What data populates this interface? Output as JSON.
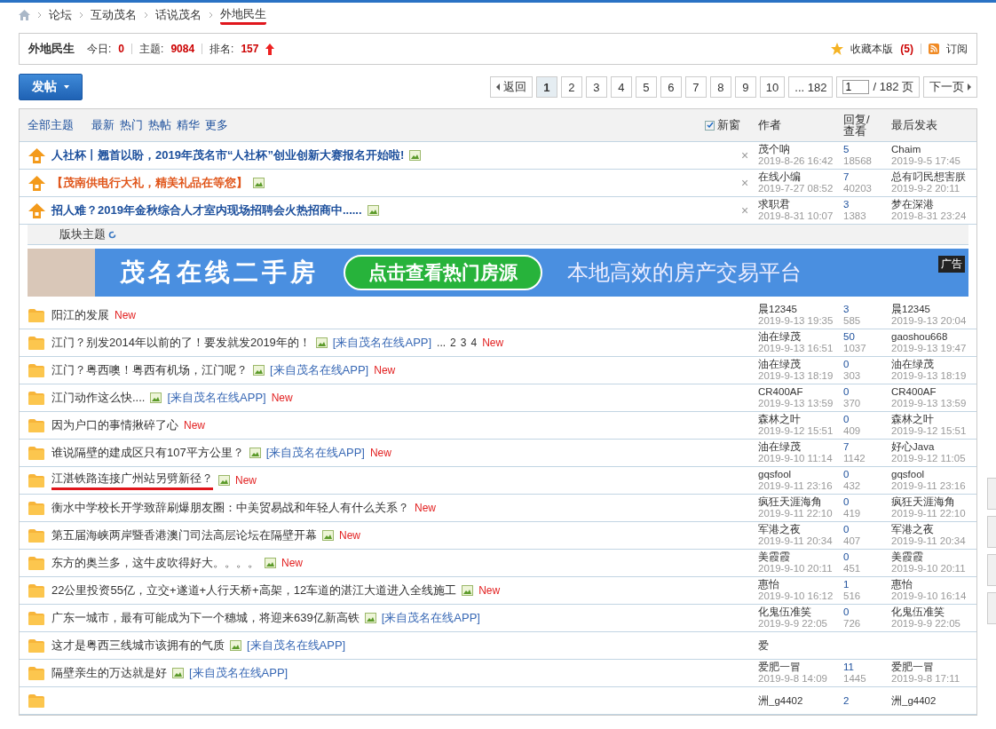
{
  "breadcrumb": [
    {
      "label": "论坛",
      "marked": false
    },
    {
      "label": "互动茂名",
      "marked": false
    },
    {
      "label": "话说茂名",
      "marked": false
    },
    {
      "label": "外地民生",
      "marked": true
    }
  ],
  "forum_header": {
    "name": "外地民生",
    "today_label": "今日:",
    "today": "0",
    "topics_label": "主题:",
    "topics": "9084",
    "rank_label": "排名:",
    "rank": "157",
    "favorite": "收藏本版",
    "favorite_count": "(5)",
    "subscribe": "订阅"
  },
  "post_button": "发帖",
  "pagination": {
    "back": "返回",
    "pages": [
      {
        "label": "1",
        "selected": true
      },
      {
        "label": "2",
        "selected": false
      },
      {
        "label": "3",
        "selected": false
      },
      {
        "label": "4",
        "selected": false
      },
      {
        "label": "5",
        "selected": false
      },
      {
        "label": "6",
        "selected": false
      },
      {
        "label": "7",
        "selected": false
      },
      {
        "label": "8",
        "selected": false
      },
      {
        "label": "9",
        "selected": false
      },
      {
        "label": "10",
        "selected": false
      },
      {
        "label": "... 182",
        "selected": false
      }
    ],
    "page_input": "1",
    "page_total": "/ 182 页",
    "next": "下一页"
  },
  "filters": [
    {
      "label": "全部主题",
      "kind": "main"
    },
    {
      "label": "最新",
      "kind": "sub"
    },
    {
      "label": "热门",
      "kind": "sub"
    },
    {
      "label": "热帖",
      "kind": "sub"
    },
    {
      "label": "精华",
      "kind": "sub"
    },
    {
      "label": "更多",
      "kind": "sub"
    }
  ],
  "new_window": {
    "label": "新窗",
    "checked": true
  },
  "columns": {
    "author": "作者",
    "replies": "回复/查看",
    "last": "最后发表"
  },
  "stickies": [
    {
      "title": "人社杯丨翘首以盼，2019年茂名市“人社杯”创业创新大赛报名开始啦!",
      "color": "#1c4f9c",
      "has_image": true,
      "close": "×",
      "author": "茂个呐",
      "date": "2019-8-26 16:42",
      "replies": "5",
      "views": "18568",
      "last_poster": "Chaim",
      "last_date": "2019-9-5 17:45"
    },
    {
      "title": "【茂南供电行大礼，精美礼品在等您】",
      "color": "#e0561b",
      "has_image": true,
      "close": "×",
      "author": "在线小编",
      "date": "2019-7-27 08:52",
      "replies": "7",
      "views": "40203",
      "last_poster": "总有叼民想害朕",
      "last_date": "2019-9-2 20:11"
    },
    {
      "title": "招人难？2019年金秋综合人才室内现场招聘会火热招商中......",
      "color": "#1c4f9c",
      "has_image": true,
      "close": "×",
      "author": "求职君",
      "date": "2019-8-31 10:07",
      "replies": "3",
      "views": "1383",
      "last_poster": "梦在深港",
      "last_date": "2019-8-31 23:24"
    }
  ],
  "section_label": "版块主题",
  "banner": {
    "headline": "茂名在线二手房",
    "button": "点击查看热门房源",
    "slogan": "本地高效的房产交易平台",
    "ad_tag": "广告"
  },
  "threads": [
    {
      "title": "阳江的发展",
      "has_image": false,
      "new": "New",
      "author": "晨12345",
      "date": "2019-9-13 19:35",
      "replies": "3",
      "views": "585",
      "last_poster": "晨12345",
      "last_date": "2019-9-13 20:04"
    },
    {
      "title": "江门？别发2014年以前的了！要发就发2019年的！",
      "has_image": true,
      "app": "[来自茂名在线APP]",
      "pages": [
        "...",
        "2",
        "3",
        "4"
      ],
      "new": "New",
      "author": "油在绿茂",
      "date": "2019-9-13 16:51",
      "replies": "50",
      "views": "1037",
      "last_poster": "gaoshou668",
      "last_date": "2019-9-13 19:47"
    },
    {
      "title": "江门？粤西噢！粤西有机场，江门呢？",
      "has_image": true,
      "app": "[来自茂名在线APP]",
      "new": "New",
      "author": "油在绿茂",
      "date": "2019-9-13 18:19",
      "replies": "0",
      "views": "303",
      "last_poster": "油在绿茂",
      "last_date": "2019-9-13 18:19"
    },
    {
      "title": "江门动作这么快....",
      "has_image": true,
      "app": "[来自茂名在线APP]",
      "new": "New",
      "author": "CR400AF",
      "date": "2019-9-13 13:59",
      "replies": "0",
      "views": "370",
      "last_poster": "CR400AF",
      "last_date": "2019-9-13 13:59"
    },
    {
      "title": "因为户口的事情揪碎了心",
      "has_image": false,
      "new": "New",
      "author": "森林之叶",
      "date": "2019-9-12 15:51",
      "replies": "0",
      "views": "409",
      "last_poster": "森林之叶",
      "last_date": "2019-9-12 15:51"
    },
    {
      "title": "谁说隔壁的建成区只有107平方公里？",
      "has_image": true,
      "app": "[来自茂名在线APP]",
      "new": "New",
      "author": "油在绿茂",
      "date": "2019-9-10 11:14",
      "replies": "7",
      "views": "1142",
      "last_poster": "好心Java",
      "last_date": "2019-9-12 11:05"
    },
    {
      "title": "江湛铁路连接广州站另劈新径？",
      "has_image": true,
      "new": "New",
      "author": "gqsfool",
      "date": "2019-9-11 23:16",
      "replies": "0",
      "views": "432",
      "last_poster": "gqsfool",
      "last_date": "2019-9-11 23:16",
      "marked": true
    },
    {
      "title": "衡水中学校长开学致辞刷爆朋友圈：中美贸易战和年轻人有什么关系？",
      "has_image": false,
      "new": "New",
      "author": "疯狂天涯海角",
      "date": "2019-9-11 22:10",
      "replies": "0",
      "views": "419",
      "last_poster": "疯狂天涯海角",
      "last_date": "2019-9-11 22:10"
    },
    {
      "title": "第五届海峡两岸暨香港澳门司法高层论坛在隔壁开幕",
      "has_image": true,
      "new": "New",
      "author": "军港之夜",
      "date": "2019-9-11 20:34",
      "replies": "0",
      "views": "407",
      "last_poster": "军港之夜",
      "last_date": "2019-9-11 20:34"
    },
    {
      "title": "东方的奥兰多，这牛皮吹得好大。。。。",
      "has_image": true,
      "new": "New",
      "author": "美霞霞",
      "date": "2019-9-10 20:11",
      "replies": "0",
      "views": "451",
      "last_poster": "美霞霞",
      "last_date": "2019-9-10 20:11"
    },
    {
      "title": "22公里投资55亿，立交+遂道+人行天桥+高架，12车道的湛江大道进入全线施工",
      "has_image": true,
      "new": "New",
      "author": "惠怡",
      "date": "2019-9-10 16:12",
      "replies": "1",
      "views": "516",
      "last_poster": "惠怡",
      "last_date": "2019-9-10 16:14"
    },
    {
      "title": "广东一城市，最有可能成为下一个穗城，将迎来639亿新高铁",
      "has_image": true,
      "app": "[来自茂名在线APP]",
      "author": "化鬼伍准笑",
      "date": "2019-9-9 22:05",
      "replies": "0",
      "views": "726",
      "last_poster": "化鬼伍准笑",
      "last_date": "2019-9-9 22:05"
    },
    {
      "title": "这才是粤西三线城市该拥有的气质",
      "has_image": true,
      "app": "[来自茂名在线APP]",
      "author": "爱"
    },
    {
      "title": "隔壁亲生的万达就是好",
      "has_image": true,
      "app": "[来自茂名在线APP]",
      "author": "爱肥一冒",
      "date": "2019-9-8 14:09",
      "replies": "11",
      "views": "1445",
      "last_poster": "爱肥一冒",
      "last_date": "2019-9-8 17:11"
    },
    {
      "author": "洲_g4402",
      "replies": "2",
      "last_poster": "洲_g4402"
    }
  ]
}
